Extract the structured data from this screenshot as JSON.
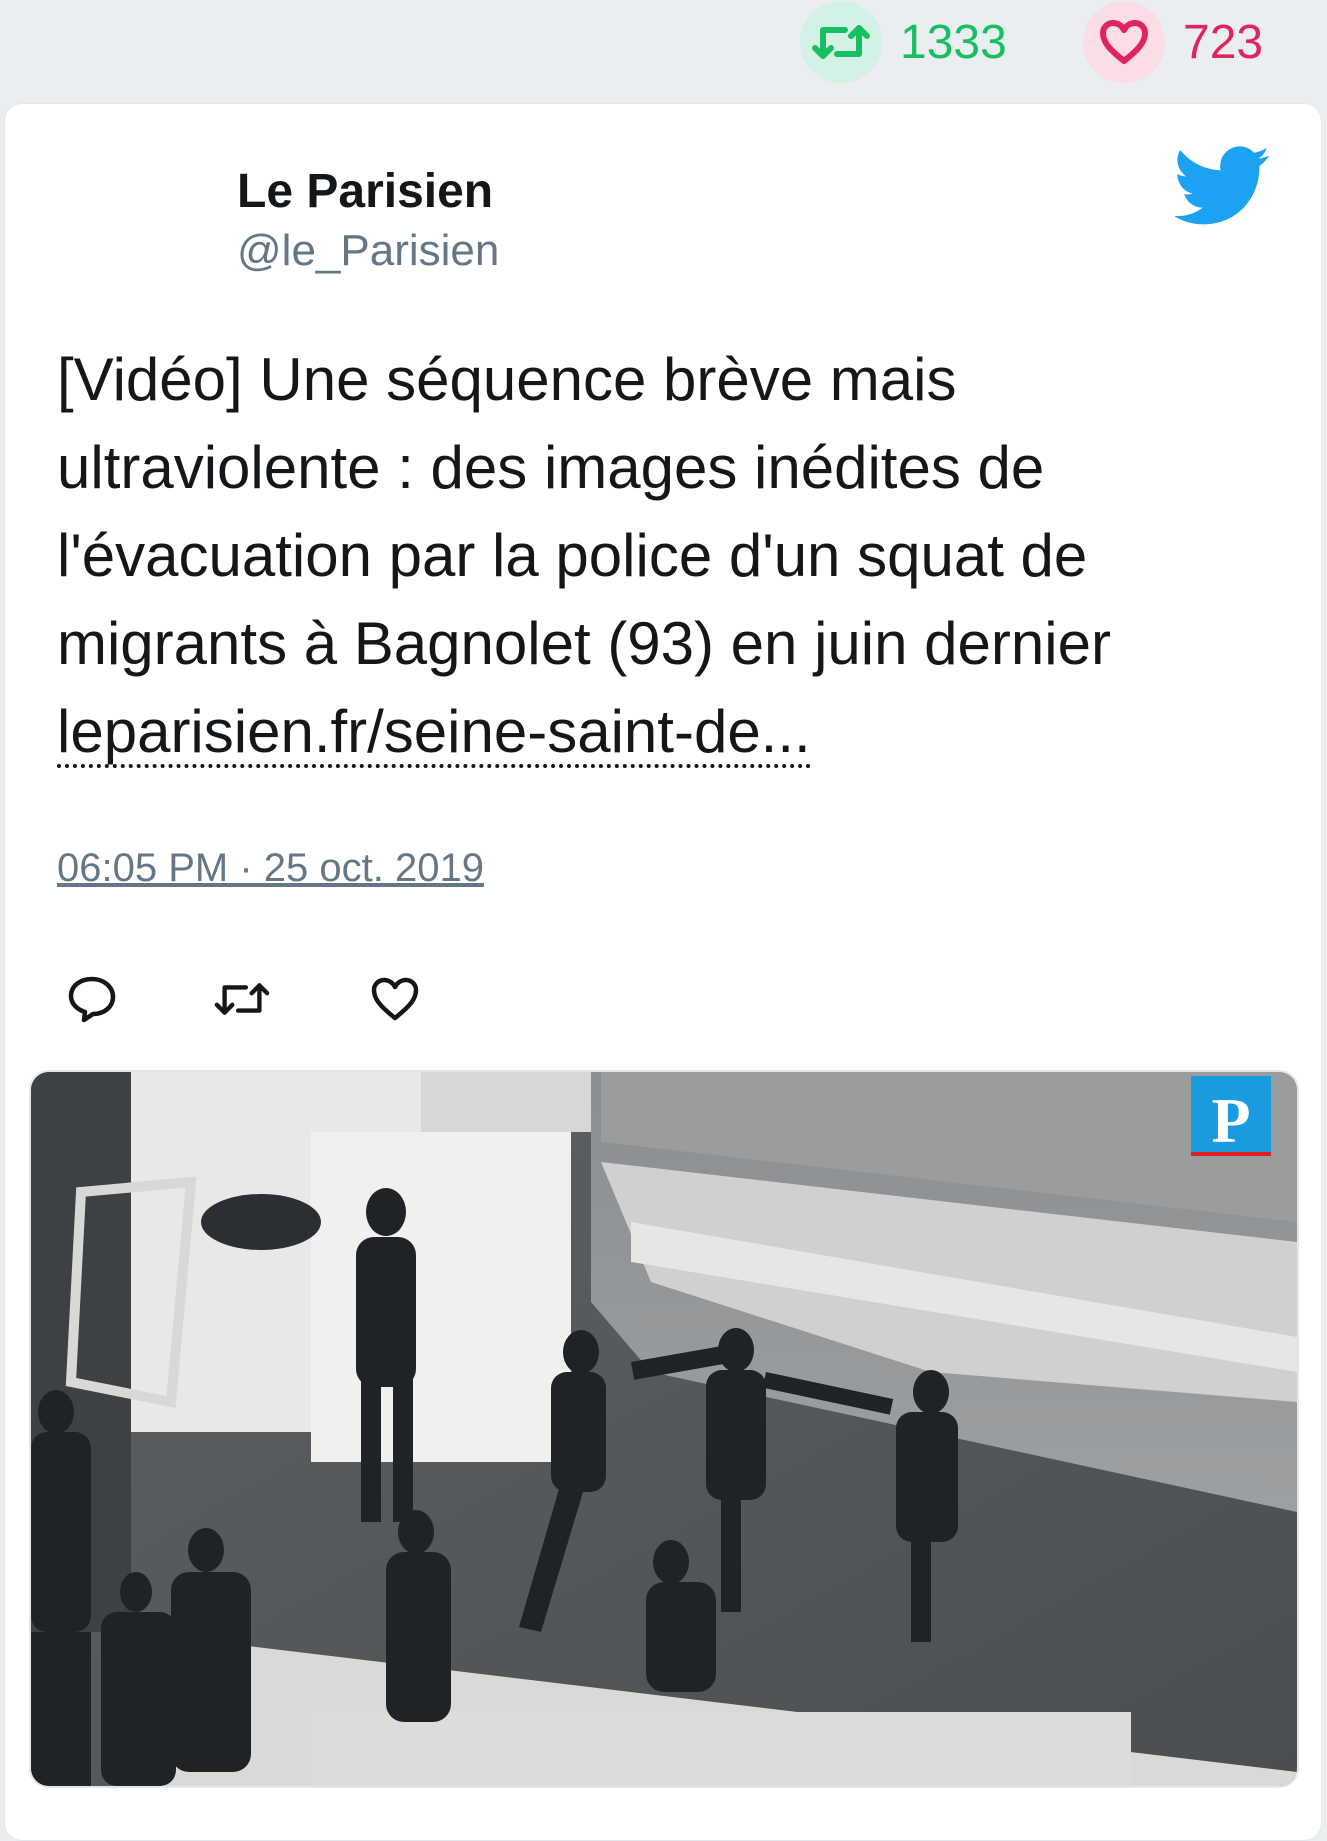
{
  "stats": {
    "retweets": "1333",
    "likes": "723",
    "retweet_icon": "retweet-icon",
    "like_icon": "heart-icon"
  },
  "tweet": {
    "author_name": "Le Parisien",
    "author_handle": "@le_Parisien",
    "text_lines": [
      "[Vidéo] Une séquence brève mais",
      "ultraviolente : des images inédites de",
      "l'évacuation par la police d'un squat de",
      "migrants à Bagnolet (93) en juin dernier"
    ],
    "link_text": "leparisien.fr/seine-saint-de...",
    "timestamp": "06:05 PM · 25 oct. 2019"
  },
  "actions": [
    "reply-icon",
    "retweet-icon",
    "heart-icon"
  ],
  "media": {
    "logo_letter": "P",
    "description_icon": "video-thumbnail"
  },
  "colors": {
    "retweet_green": "#17bf63",
    "like_red": "#e0245e",
    "twitter_blue": "#1da1f2",
    "text": "#14171a",
    "muted": "#657786"
  }
}
